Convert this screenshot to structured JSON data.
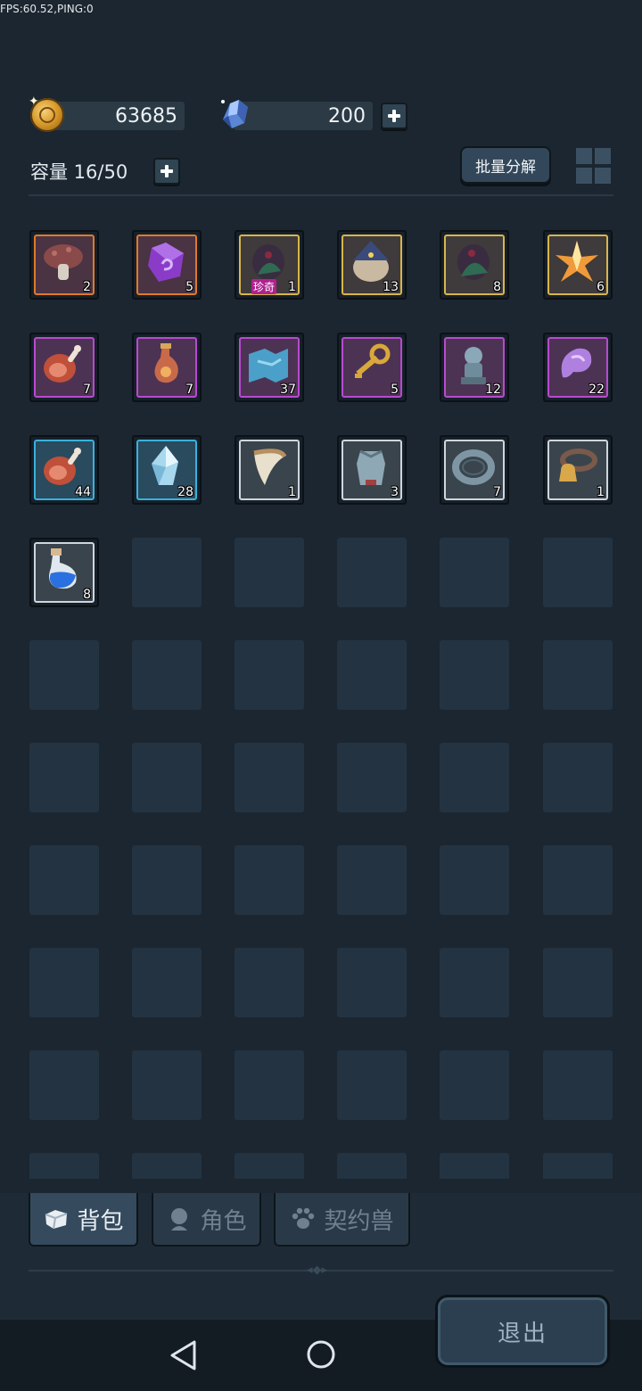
{
  "status": {
    "fps_text": "FPS:60.52,PING:0"
  },
  "currency": {
    "gold": {
      "value": "63685",
      "icon": "gold-coin-icon"
    },
    "gem": {
      "value": "200",
      "icon": "blue-crystal-icon"
    }
  },
  "capacity": {
    "label": "容量 16/50"
  },
  "toolbar": {
    "batch_decompose_label": "批量分解",
    "grid_toggle_icon": "grid-view-icon"
  },
  "inventory": {
    "items": [
      {
        "name": "mushroom",
        "rarity": "orange",
        "count": "2",
        "tag": ""
      },
      {
        "name": "purple-rune-stone",
        "rarity": "orange",
        "count": "5",
        "tag": ""
      },
      {
        "name": "dark-leaf-egg-rare",
        "rarity": "gold",
        "count": "1",
        "tag": "珍奇"
      },
      {
        "name": "wizard-hat-egg",
        "rarity": "gold",
        "count": "13",
        "tag": ""
      },
      {
        "name": "dark-leaf-egg",
        "rarity": "gold",
        "count": "8",
        "tag": ""
      },
      {
        "name": "star-crystal",
        "rarity": "gold",
        "count": "6",
        "tag": ""
      },
      {
        "name": "meat-drumstick",
        "rarity": "purple",
        "count": "7",
        "tag": ""
      },
      {
        "name": "potion-flask",
        "rarity": "purple",
        "count": "7",
        "tag": ""
      },
      {
        "name": "blue-map-scroll",
        "rarity": "purple",
        "count": "37",
        "tag": ""
      },
      {
        "name": "golden-key",
        "rarity": "purple",
        "count": "5",
        "tag": ""
      },
      {
        "name": "stone-statue",
        "rarity": "purple",
        "count": "12",
        "tag": ""
      },
      {
        "name": "purple-shell",
        "rarity": "purple",
        "count": "22",
        "tag": ""
      },
      {
        "name": "meat-drumstick",
        "rarity": "blue",
        "count": "44",
        "tag": ""
      },
      {
        "name": "ice-crystal",
        "rarity": "blue",
        "count": "28",
        "tag": ""
      },
      {
        "name": "fang-claw",
        "rarity": "white",
        "count": "1",
        "tag": ""
      },
      {
        "name": "iron-armor",
        "rarity": "white",
        "count": "3",
        "tag": ""
      },
      {
        "name": "metal-ring",
        "rarity": "white",
        "count": "7",
        "tag": ""
      },
      {
        "name": "bell-collar",
        "rarity": "white",
        "count": "1",
        "tag": ""
      },
      {
        "name": "blue-potion",
        "rarity": "white",
        "count": "8",
        "tag": ""
      }
    ]
  },
  "tabs": [
    {
      "label": "背包",
      "icon": "backpack-icon",
      "active": true
    },
    {
      "label": "角色",
      "icon": "character-icon",
      "active": false
    },
    {
      "label": "契约兽",
      "icon": "paw-icon",
      "active": false
    }
  ],
  "footer": {
    "exit_label": "退出"
  },
  "colors": {
    "background": "#1b2631",
    "rarity_orange": "#e07a2a",
    "rarity_gold": "#d8b64a",
    "rarity_purple": "#b84ad0",
    "rarity_blue": "#3ab2dc",
    "rarity_white": "#cfd6dc"
  }
}
